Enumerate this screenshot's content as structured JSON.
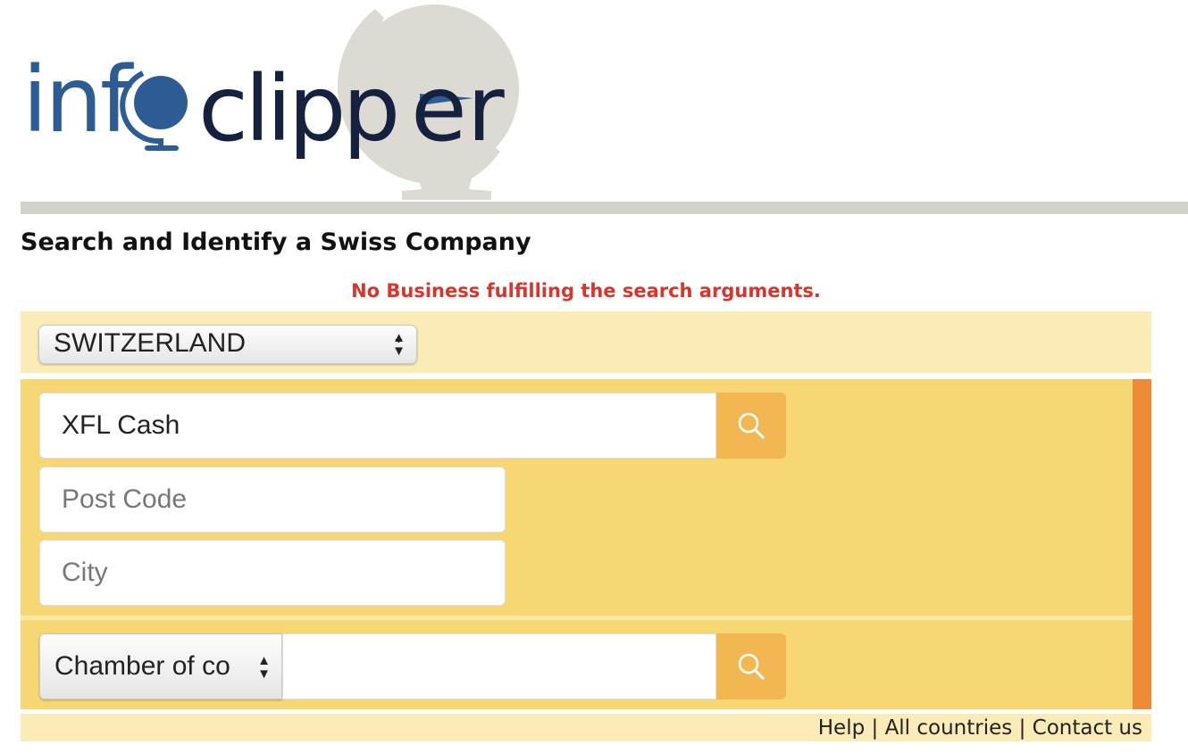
{
  "brand": {
    "logo_text": "infoclipper",
    "logo_colors": {
      "info": "#2d5b94",
      "clipper": "#14223f",
      "globe_bg": "#dcdad2"
    }
  },
  "page": {
    "title": "Search and Identify a Swiss Company",
    "error_message": "No Business fulfilling the search arguments."
  },
  "country_select": {
    "value": "SWITZERLAND"
  },
  "search": {
    "company_value": "XFL Cash",
    "postcode_placeholder": "Post Code",
    "city_placeholder": "City",
    "chamber_select_value": "Chamber of co",
    "chamber_value": "",
    "search_icon": "search-icon"
  },
  "footer": {
    "links": [
      "Help",
      "All countries",
      "Contact us"
    ],
    "separator": "|"
  },
  "colors": {
    "panel_light": "#fbebb7",
    "panel": "#f7d774",
    "accent": "#ef8a37",
    "button": "#f3b752",
    "error": "#d9352a"
  }
}
